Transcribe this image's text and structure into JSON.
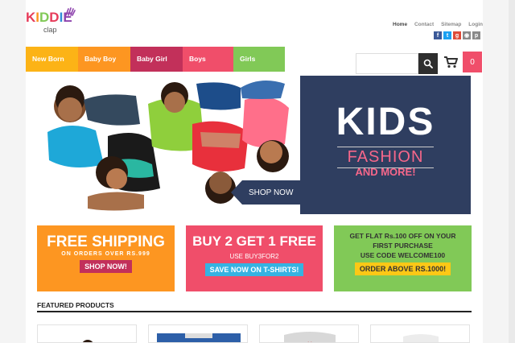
{
  "logo": {
    "main": [
      "K",
      "I",
      "D",
      "D",
      "I",
      "E"
    ],
    "sub": "clap",
    "colors": [
      "#e63c5a",
      "#fd9621",
      "#81c957",
      "#e63c5a",
      "#2f8fd8",
      "#8e44ad"
    ]
  },
  "top_links": [
    {
      "label": "Home",
      "active": true
    },
    {
      "label": "Contact",
      "active": false
    },
    {
      "label": "Sitemap",
      "active": false
    },
    {
      "label": "Login",
      "active": false
    }
  ],
  "socials": [
    {
      "icon": "facebook-icon",
      "glyph": "f",
      "color": "#3b5998"
    },
    {
      "icon": "twitter-icon",
      "glyph": "t",
      "color": "#1da1f2"
    },
    {
      "icon": "google-plus-icon",
      "glyph": "g",
      "color": "#dd4b39"
    },
    {
      "icon": "instagram-icon",
      "glyph": "◉",
      "color": "#8a8a8a"
    },
    {
      "icon": "pinterest-icon",
      "glyph": "p",
      "color": "#8a8a8a"
    }
  ],
  "nav": [
    {
      "label": "New Born",
      "color": "#fcb316"
    },
    {
      "label": "Baby Boy",
      "color": "#fd9621"
    },
    {
      "label": "Baby Girl",
      "color": "#c2305a"
    },
    {
      "label": "Boys",
      "color": "#f04e6a"
    },
    {
      "label": "Girls",
      "color": "#81c957"
    }
  ],
  "search": {
    "placeholder": ""
  },
  "cart": {
    "count": "0"
  },
  "banner": {
    "title": "KIDS",
    "subtitle": "FASHION",
    "tagline": "AND MORE!",
    "cta": "SHOP NOW"
  },
  "promos": [
    {
      "big": "FREE SHIPPING",
      "small": "ON ORDERS OVER RS.999",
      "button": "SHOP NOW!",
      "button_color": "#c2305a"
    },
    {
      "big": "BUY 2 GET 1 FREE",
      "small": "USE BUY3FOR2",
      "button": "SAVE NOW ON T-SHIRTS!",
      "button_color": "#35b3e2"
    },
    {
      "lines": [
        "GET FLAT Rs.100 OFF ON YOUR",
        "FIRST PURCHASE",
        "USE CODE WELCOME100"
      ],
      "button": "ORDER ABOVE RS.1000!",
      "button_color": "#fcc816"
    }
  ],
  "featured": {
    "title": "FEATURED PRODUCTS"
  }
}
